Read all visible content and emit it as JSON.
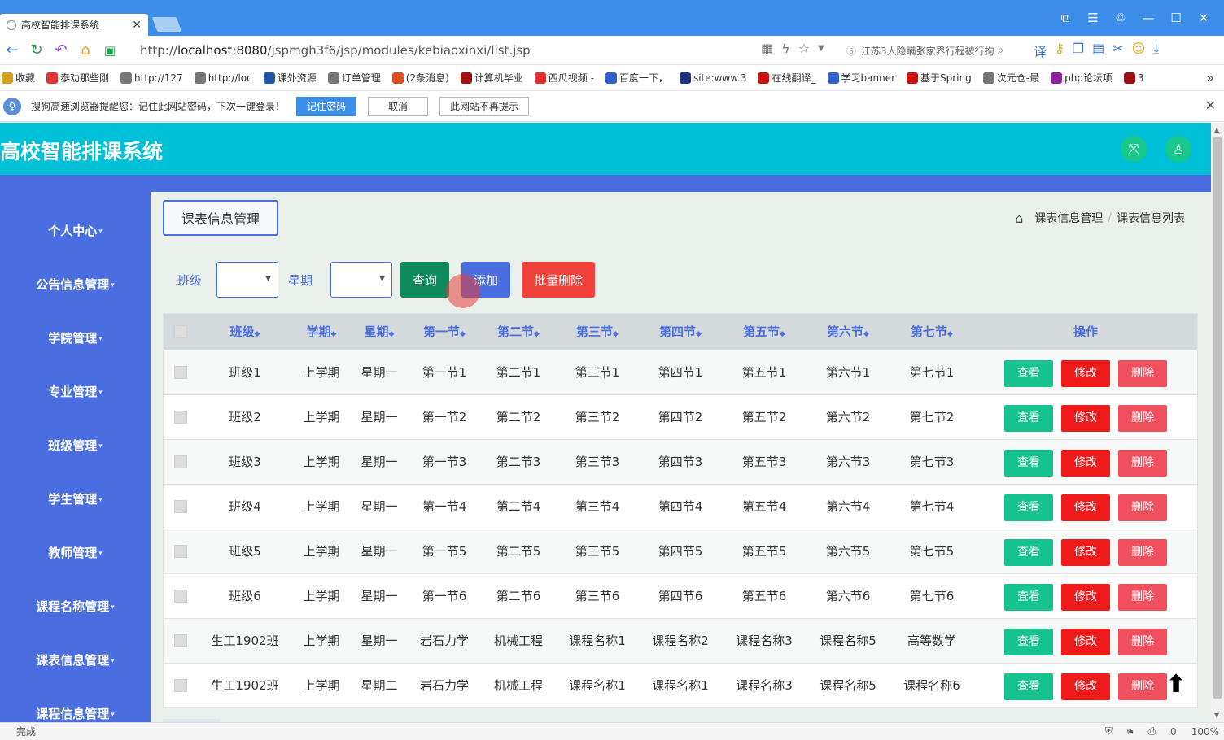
{
  "browser": {
    "tab_title": "高校智能排课系统",
    "url_prefix": "http://",
    "url_host": "localhost:8080",
    "url_path": "/jspmgh3f6/jsp/modules/kebiaoxinxi/list.jsp",
    "search_text": "江苏3人隐瞒张家界行程被行拘",
    "bookmarks": [
      "收藏",
      "泰劝那些刚",
      "http://127",
      "http://loc",
      "课外资源",
      "订单管理",
      "(2条消息)",
      "计算机毕业",
      "西瓜视频 -",
      "百度一下，",
      "site:www.3",
      "在线翻译_",
      "学习banner",
      "基于Spring",
      "次元仓-最",
      "php论坛项",
      "3"
    ],
    "notify_text": "搜狗高速浏览器提醒您：记住此网站密码，下次一键登录！",
    "notify_btn_remember": "记住密码",
    "notify_btn_cancel": "取消",
    "notify_btn_never": "此网站不再提示",
    "status_text": "完成",
    "status_count": "0",
    "zoom": "100%"
  },
  "app": {
    "title": "高校智能排课系统"
  },
  "sidebar": {
    "items": [
      "个人中心",
      "公告信息管理",
      "学院管理",
      "专业管理",
      "班级管理",
      "学生管理",
      "教师管理",
      "课程名称管理",
      "课表信息管理",
      "课程信息管理"
    ]
  },
  "main": {
    "page_tag": "课表信息管理",
    "breadcrumb": [
      "课表信息管理",
      "课表信息列表"
    ],
    "filters": {
      "class_label": "班级",
      "weekday_label": "星期",
      "search_btn": "查询",
      "add_btn": "添加",
      "batch_delete_btn": "批量删除"
    }
  },
  "table": {
    "headers": [
      "班级",
      "学期",
      "星期",
      "第一节",
      "第二节",
      "第三节",
      "第四节",
      "第五节",
      "第六节",
      "第七节"
    ],
    "action_header": "操作",
    "view_label": "查看",
    "edit_label": "修改",
    "delete_label": "删除",
    "rows": [
      [
        "班级1",
        "上学期",
        "星期一",
        "第一节1",
        "第二节1",
        "第三节1",
        "第四节1",
        "第五节1",
        "第六节1",
        "第七节1"
      ],
      [
        "班级2",
        "上学期",
        "星期一",
        "第一节2",
        "第二节2",
        "第三节2",
        "第四节2",
        "第五节2",
        "第六节2",
        "第七节2"
      ],
      [
        "班级3",
        "上学期",
        "星期一",
        "第一节3",
        "第二节3",
        "第三节3",
        "第四节3",
        "第五节3",
        "第六节3",
        "第七节3"
      ],
      [
        "班级4",
        "上学期",
        "星期一",
        "第一节4",
        "第二节4",
        "第三节4",
        "第四节4",
        "第五节4",
        "第六节4",
        "第七节4"
      ],
      [
        "班级5",
        "上学期",
        "星期一",
        "第一节5",
        "第二节5",
        "第三节5",
        "第四节5",
        "第五节5",
        "第六节5",
        "第七节5"
      ],
      [
        "班级6",
        "上学期",
        "星期一",
        "第一节6",
        "第二节6",
        "第三节6",
        "第四节6",
        "第五节6",
        "第六节6",
        "第七节6"
      ],
      [
        "生工1902班",
        "上学期",
        "星期一",
        "岩石力学",
        "机械工程",
        "课程名称1",
        "课程名称2",
        "课程名称3",
        "课程名称5",
        "高等数学"
      ],
      [
        "生工1902班",
        "上学期",
        "星期二",
        "岩石力学",
        "机械工程",
        "课程名称1",
        "课程名称1",
        "课程名称3",
        "课程名称5",
        "课程名称6"
      ]
    ]
  },
  "colors": {
    "header_bg": "#00c0d8",
    "sidebar_bg": "#4a6ee0",
    "content_bg": "#eaf1ec",
    "view_btn": "#16c28e",
    "edit_btn": "#ef1a1a",
    "delete_btn": "#f0505e"
  }
}
